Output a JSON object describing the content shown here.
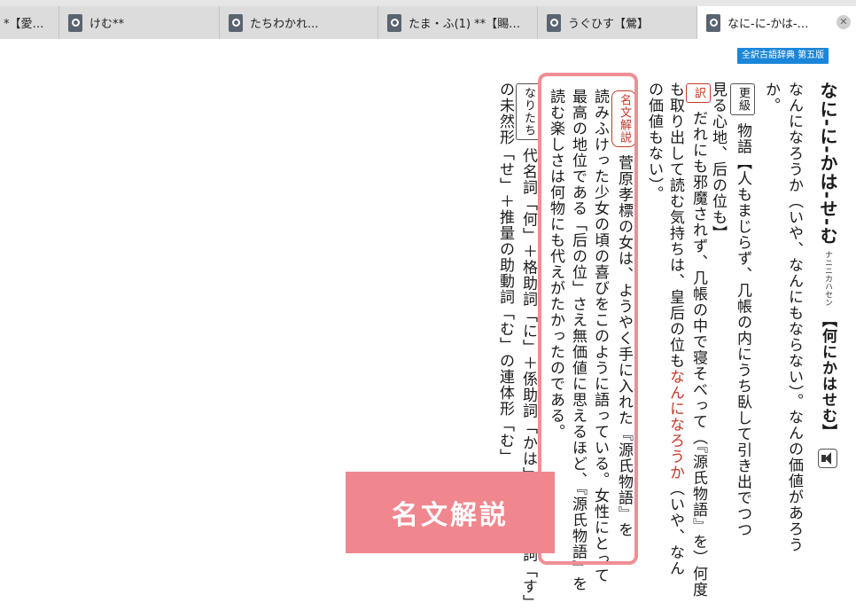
{
  "tabs": [
    {
      "label": "*【愛…",
      "active": false,
      "closable": false
    },
    {
      "label": "けむ**",
      "active": false,
      "closable": false
    },
    {
      "label": "たちわかれ...",
      "active": false,
      "closable": false
    },
    {
      "label": "たま・ふ(1) **【賜…",
      "active": false,
      "closable": false
    },
    {
      "label": "うぐひす【鶯】",
      "active": false,
      "closable": false
    },
    {
      "label": "なに-に-かは-…",
      "active": true,
      "closable": true
    }
  ],
  "dictionary_badge": "全訳古語辞典 第五版",
  "entry": {
    "headword": "なに‐に‐かは‐せ‐む",
    "reading": "ナニニカハセン",
    "kanji": "【何にかはせむ】",
    "def_line1": "なんになろうか（いや、なんにもならない）。なんの価値があろう",
    "def_line2": "か。",
    "example_tag": "更級",
    "example_line1": "物語【人もまじらず、几帳の内にうち臥して引き出でつつ",
    "example_line2": "見る心地、后の位も】",
    "translation_tag": "訳",
    "translation_line1": "だれにも邪魔されず、几帳の中で寝そべって（『源氏物語』を）何度",
    "translation_line2a": "も取り出して読む気持ちは、皇后の位も",
    "translation_highlight": "なんになろうか",
    "translation_line2b": "（いや、なん",
    "translation_line3": "の価値もない）。",
    "commentary_tag": "名文解説",
    "commentary_line1": "菅原孝標の女は、ようやく手に入れた『源氏物語』を",
    "commentary_line2": "読みふけった少女の頃の喜びをこのように語っている。女性にとって",
    "commentary_line3": "最高の地位である「后の位」さえ無価値に思えるほど、『源氏物語』を",
    "commentary_line4": "読む楽しさは何物にも代えがたかったのである。",
    "etymology_tag": "なりたち",
    "etymology_line1": "代名詞「何」＋格助詞「に」＋係助詞「かは」＋サ変動詞「す」",
    "etymology_line2": "の未然形「せ」＋推量の助動詞「む」の連体形「む」"
  },
  "overlay_label": "名文解説",
  "colors": {
    "highlight_border": "#ef8e95",
    "overlay_bg": "#f0878e",
    "accent_red": "#c0392b",
    "badge_blue": "#1a86d9"
  },
  "icons": [
    "dictionary-app-icon",
    "close-icon",
    "speaker-icon"
  ]
}
